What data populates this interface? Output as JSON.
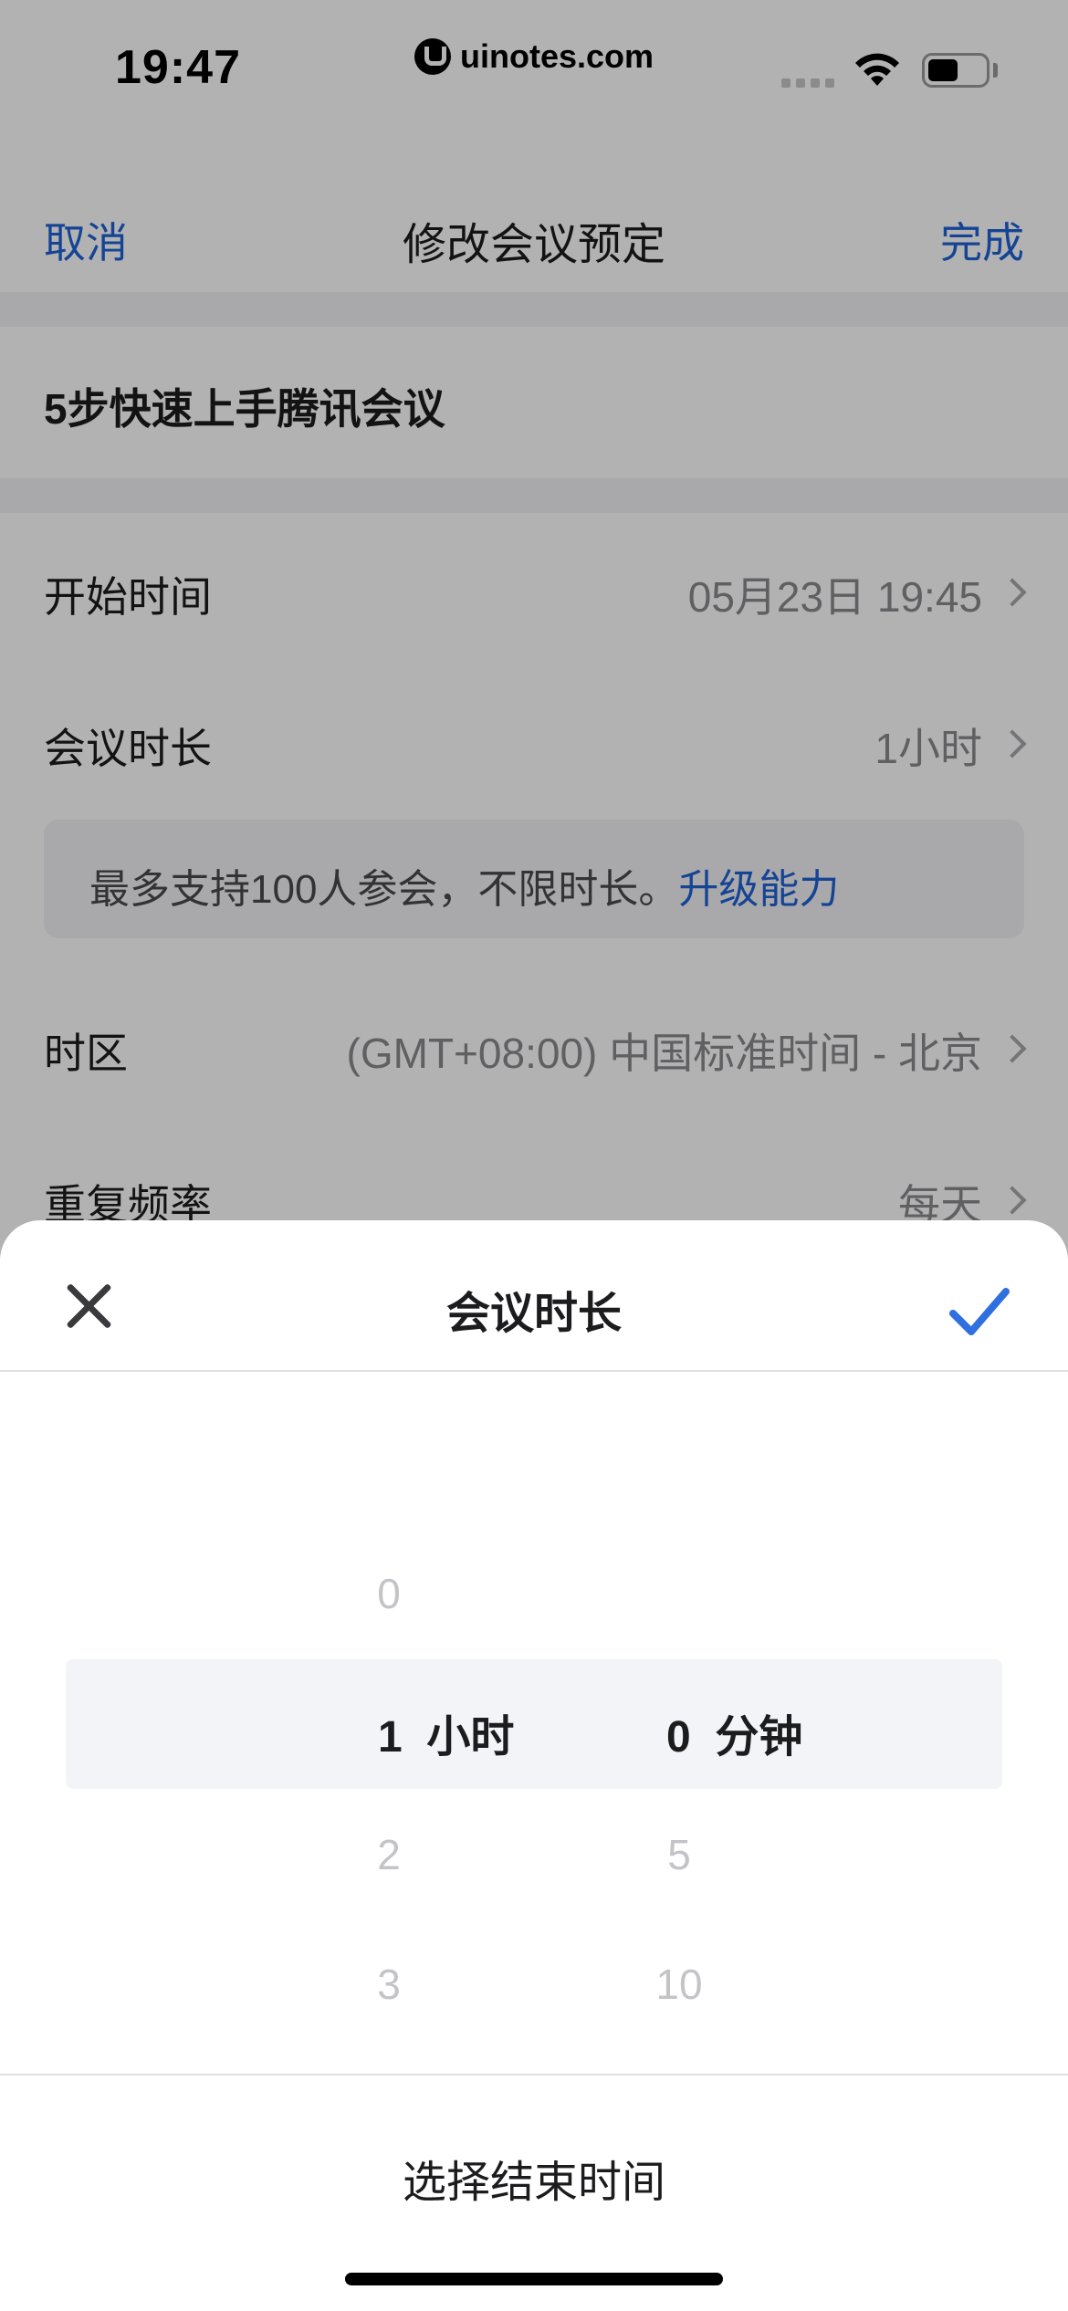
{
  "status_bar": {
    "time": "19:47",
    "watermark": "uinotes.com",
    "icons": [
      "cellular-signal-icon",
      "wifi-icon",
      "battery-icon"
    ]
  },
  "navbar": {
    "cancel_label": "取消",
    "title": "修改会议预定",
    "done_label": "完成"
  },
  "meeting": {
    "title": "5步快速上手腾讯会议"
  },
  "settings": {
    "start_time": {
      "label": "开始时间",
      "value": "05月23日 19:45"
    },
    "duration": {
      "label": "会议时长",
      "value": "1小时"
    },
    "notice": {
      "text": "最多支持100人参会，不限时长。",
      "link": "升级能力"
    },
    "timezone": {
      "label": "时区",
      "value": "(GMT+08:00) 中国标准时间 - 北京"
    },
    "repeat": {
      "label": "重复频率",
      "value": "每天"
    }
  },
  "sheet": {
    "title": "会议时长",
    "hours": {
      "above": "0",
      "selected": "1",
      "unit": "小时",
      "below": [
        "2",
        "3"
      ]
    },
    "minutes": {
      "selected": "0",
      "unit": "分钟",
      "below": [
        "5",
        "10"
      ]
    },
    "end_time_label": "选择结束时间"
  },
  "colors": {
    "accent": "#1f62d6",
    "confirm_check": "#2f6fe0",
    "overlay": "rgba(0,0,0,0.30)"
  }
}
